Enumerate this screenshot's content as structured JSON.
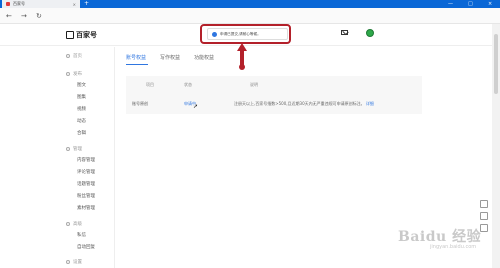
{
  "browser": {
    "tab_title": "百家号",
    "tab_close": "×",
    "new_tab": "+",
    "minimize": "—",
    "maximize": "□",
    "close": "×",
    "back": "←",
    "forward": "→",
    "reload": "↻"
  },
  "header": {
    "logo_text": "百家号",
    "toast_message": "申请已提交,请耐心等候。"
  },
  "sidebar": {
    "groups": [
      {
        "label": "首页"
      },
      {
        "label": "发布"
      },
      {
        "label": "管理"
      },
      {
        "label": "高级"
      },
      {
        "label": "设置"
      }
    ],
    "publish_items": [
      "图文",
      "图集",
      "视频",
      "动态",
      "合辑"
    ],
    "manage_items": [
      "内容管理",
      "评论管理",
      "话题管理",
      "粉丝管理",
      "素材管理"
    ],
    "advanced_items": [
      "私信",
      "自动回复"
    ]
  },
  "main": {
    "tabs": [
      {
        "label": "账号权益"
      },
      {
        "label": "写作权益"
      },
      {
        "label": "功能权益"
      }
    ],
    "table": {
      "headers": [
        "项目",
        "状态",
        "说明"
      ],
      "row": {
        "item": "账号原创",
        "status": "申请中",
        "description": "注册天以上,百家号指数>500,且近期30天内无严重违规可申请原创标注。",
        "detail_link": "详细"
      }
    }
  },
  "watermark": {
    "text": "Baidu 经验",
    "sub": "jingyan.baidu.com"
  },
  "colors": {
    "accent": "#2f76e0",
    "annotation": "#b3202a",
    "chrome_blue": "#0a67d6"
  }
}
